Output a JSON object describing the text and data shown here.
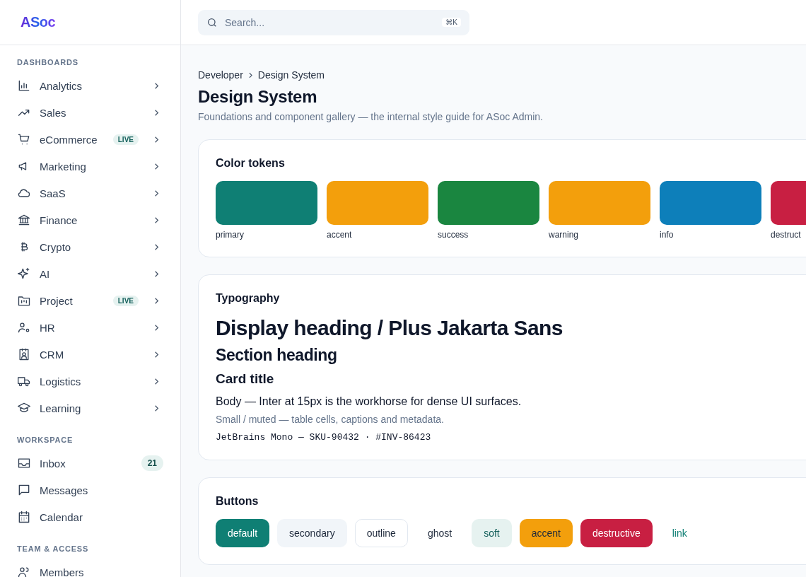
{
  "logo": "ASoc",
  "search": {
    "placeholder": "Search...",
    "shortcut": "⌘K"
  },
  "sidebar": {
    "sections": [
      {
        "title": "DASHBOARDS",
        "items": [
          {
            "label": "Analytics",
            "chevron": true
          },
          {
            "label": "Sales",
            "chevron": true
          },
          {
            "label": "eCommerce",
            "badge": "LIVE",
            "chevron": true
          },
          {
            "label": "Marketing",
            "chevron": true
          },
          {
            "label": "SaaS",
            "chevron": true
          },
          {
            "label": "Finance",
            "chevron": true
          },
          {
            "label": "Crypto",
            "chevron": true
          },
          {
            "label": "AI",
            "chevron": true
          },
          {
            "label": "Project",
            "badge": "LIVE",
            "chevron": true
          },
          {
            "label": "HR",
            "chevron": true
          },
          {
            "label": "CRM",
            "chevron": true
          },
          {
            "label": "Logistics",
            "chevron": true
          },
          {
            "label": "Learning",
            "chevron": true
          }
        ]
      },
      {
        "title": "WORKSPACE",
        "items": [
          {
            "label": "Inbox",
            "count": "21",
            "chevron": false
          },
          {
            "label": "Messages",
            "chevron": false
          },
          {
            "label": "Calendar",
            "chevron": false
          }
        ]
      },
      {
        "title": "TEAM & ACCESS",
        "items": [
          {
            "label": "Members",
            "chevron": false
          }
        ]
      }
    ]
  },
  "breadcrumb": [
    "Developer",
    "Design System"
  ],
  "title": "Design System",
  "subtitle": "Foundations and component gallery — the internal style guide for ASoc Admin.",
  "color_tokens": {
    "title": "Color tokens",
    "tokens": [
      {
        "name": "primary",
        "color": "#0f7f74"
      },
      {
        "name": "accent",
        "color": "#f39f0c"
      },
      {
        "name": "success",
        "color": "#1a8640"
      },
      {
        "name": "warning",
        "color": "#f39f0c"
      },
      {
        "name": "info",
        "color": "#0d7fba"
      },
      {
        "name": "destruct",
        "color": "#c81f42"
      }
    ]
  },
  "typography": {
    "title": "Typography",
    "samples": [
      {
        "kind": "display",
        "text": "Display heading / Plus Jakarta Sans"
      },
      {
        "kind": "section",
        "text": "Section heading"
      },
      {
        "kind": "card",
        "text": "Card title"
      },
      {
        "kind": "body",
        "text": "Body — Inter at 15px is the workhorse for dense UI surfaces."
      },
      {
        "kind": "small",
        "text": "Small / muted — table cells, captions and metadata."
      },
      {
        "kind": "mono",
        "text": "JetBrains Mono — SKU-90432 · #INV-86423"
      }
    ]
  },
  "buttons": {
    "title": "Buttons",
    "items": [
      {
        "kind": "default",
        "label": "default"
      },
      {
        "kind": "secondary",
        "label": "secondary"
      },
      {
        "kind": "outline",
        "label": "outline"
      },
      {
        "kind": "ghost",
        "label": "ghost"
      },
      {
        "kind": "soft",
        "label": "soft"
      },
      {
        "kind": "accent",
        "label": "accent"
      },
      {
        "kind": "destructive",
        "label": "destructive"
      },
      {
        "kind": "link",
        "label": "link"
      }
    ]
  }
}
